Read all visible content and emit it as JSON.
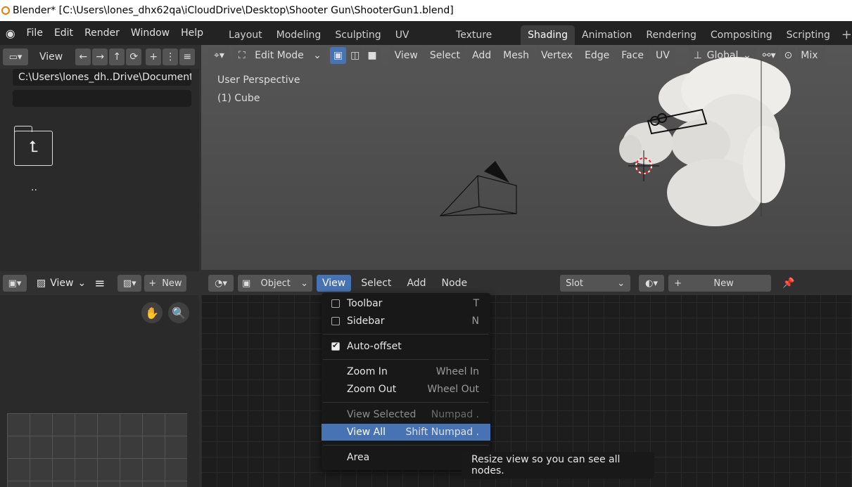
{
  "window": {
    "title": "Blender* [C:\\Users\\lones_dhx62qa\\iCloudDrive\\Desktop\\Shooter Gun\\ShooterGun1.blend]"
  },
  "menu": {
    "file": "File",
    "edit": "Edit",
    "render": "Render",
    "window": "Window",
    "help": "Help"
  },
  "workspaces": [
    "Layout",
    "Modeling",
    "Sculpting",
    "UV Editing",
    "Texture Paint",
    "Shading",
    "Animation",
    "Rendering",
    "Compositing",
    "Scripting"
  ],
  "active_workspace": "Shading",
  "file_browser": {
    "view_label": "View",
    "path": "C:\\Users\\lones_dh..Drive\\Documents\\",
    "filename": "",
    "parent_label": ".."
  },
  "viewport": {
    "mode": "Edit Mode",
    "menus": [
      "View",
      "Select",
      "Add",
      "Mesh",
      "Vertex",
      "Edge",
      "Face",
      "UV"
    ],
    "transform_orientation": "Global",
    "shading": "Mix",
    "overlay_title": "User Perspective",
    "overlay_object": "(1) Cube"
  },
  "image_editor": {
    "view_label": "View",
    "new_label": "New"
  },
  "node_editor": {
    "object_label": "Object",
    "menus": [
      "View",
      "Select",
      "Add",
      "Node"
    ],
    "slot_label": "Slot",
    "new_label": "New"
  },
  "view_menu": {
    "items": [
      {
        "label": "Toolbar",
        "shortcut": "T",
        "checkbox": false
      },
      {
        "label": "Sidebar",
        "shortcut": "N",
        "checkbox": false
      },
      {
        "label": "Auto-offset",
        "shortcut": "",
        "checkbox": true
      },
      {
        "label": "Zoom In",
        "shortcut": "Wheel In"
      },
      {
        "label": "Zoom Out",
        "shortcut": "Wheel Out"
      },
      {
        "label": "View Selected",
        "shortcut": "Numpad ."
      },
      {
        "label": "View All",
        "shortcut": "Shift Numpad ."
      },
      {
        "label": "Area",
        "shortcut": ""
      }
    ]
  },
  "tooltip": "Resize view so you can see all nodes.",
  "colors": {
    "accent": "#4772b3",
    "header": "#303030",
    "panel": "#2a2a2a"
  }
}
